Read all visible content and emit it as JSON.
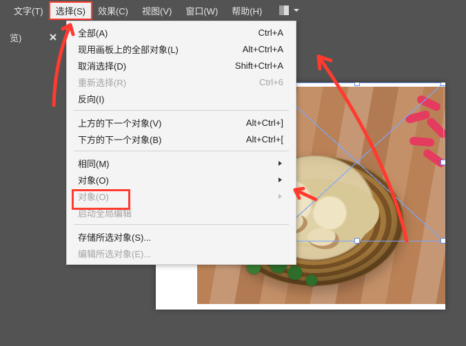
{
  "menubar": {
    "text": "文字(T)",
    "select": "选择(S)",
    "effect": "效果(C)",
    "view": "视图(V)",
    "window": "窗口(W)",
    "help": "帮助(H)"
  },
  "left_tab": {
    "label": "览)"
  },
  "dropdown": {
    "all": {
      "label": "全部(A)",
      "shortcut": "Ctrl+A"
    },
    "artboard_all": {
      "label": "现用画板上的全部对象(L)",
      "shortcut": "Alt+Ctrl+A"
    },
    "deselect": {
      "label": "取消选择(D)",
      "shortcut": "Shift+Ctrl+A"
    },
    "reselect": {
      "label": "重新选择(R)",
      "shortcut": "Ctrl+6"
    },
    "inverse": {
      "label": "反向(I)",
      "shortcut": ""
    },
    "next_above": {
      "label": "上方的下一个对象(V)",
      "shortcut": "Alt+Ctrl+]"
    },
    "next_below": {
      "label": "下方的下一个对象(B)",
      "shortcut": "Alt+Ctrl+["
    },
    "same": {
      "label": "相同(M)",
      "submenu": true
    },
    "object_highlight": {
      "label": "对象(O)",
      "submenu": true
    },
    "object2": {
      "label": "对象(O)",
      "submenu": true
    },
    "start_global": {
      "label": "启动全局编辑",
      "submenu": false
    },
    "save_sel": {
      "label": "存储所选对象(S)..."
    },
    "edit_sel": {
      "label": "编辑所选对象(E)..."
    }
  }
}
